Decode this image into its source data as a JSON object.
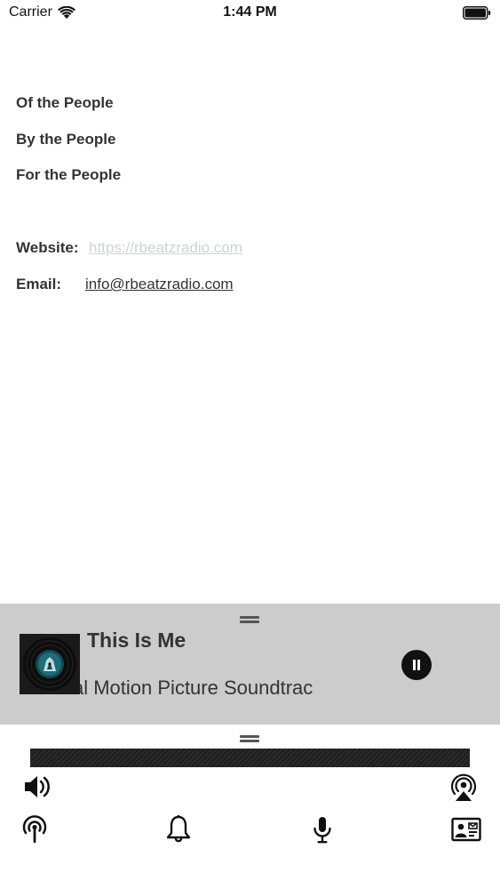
{
  "status_bar": {
    "carrier": "Carrier",
    "time": "1:44 PM"
  },
  "content": {
    "line1": "Of  the People",
    "line2": "By  the People",
    "line3": "For the People",
    "website_label": "Website:",
    "website_value": "https://rbeatzradio.com",
    "email_label": "Email:",
    "email_value": "info@rbeatzradio.com"
  },
  "player": {
    "title": "This Is Me",
    "subtitle": "al Motion Picture Soundtrac"
  },
  "controls": {
    "volume": "volume-icon",
    "airplay": "airplay-icon"
  },
  "tabs": [
    "radio-tower-icon",
    "bell-icon",
    "microphone-icon",
    "contact-card-icon"
  ]
}
